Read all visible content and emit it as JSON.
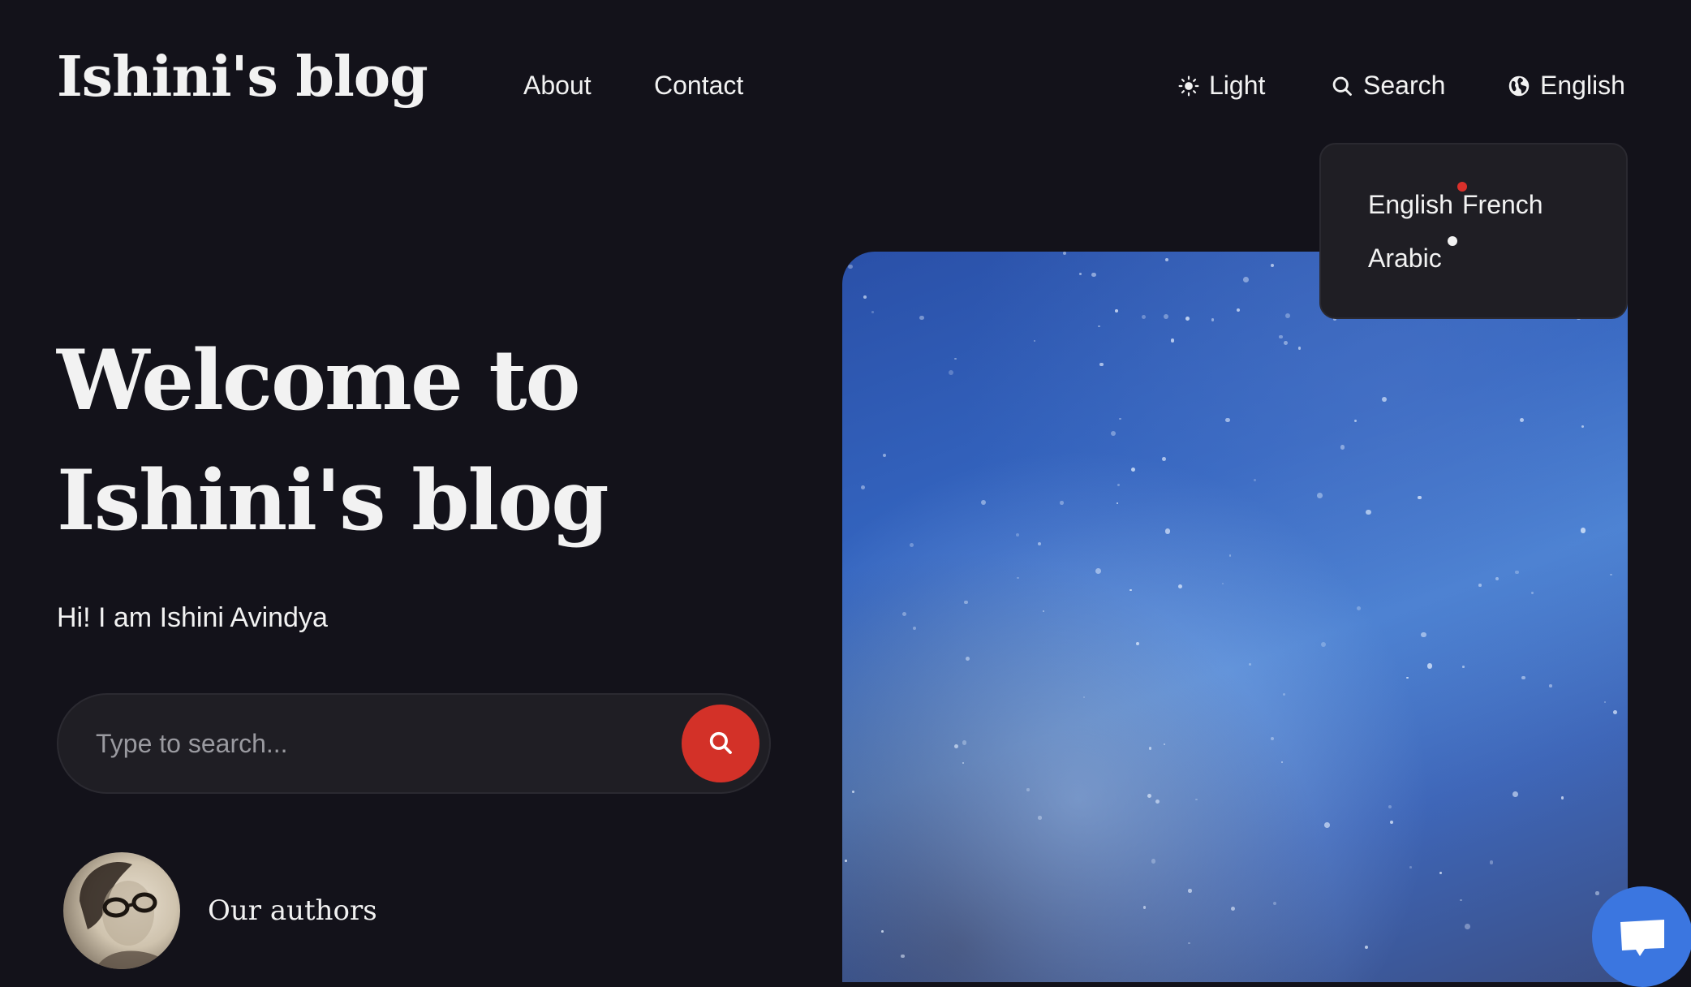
{
  "header": {
    "logo": "Ishini's blog",
    "nav": [
      {
        "label": "About"
      },
      {
        "label": "Contact"
      }
    ],
    "tools": {
      "theme_label": "Light",
      "theme_icon": "sun-icon",
      "search_label": "Search",
      "search_icon": "search-icon",
      "language_label": "English",
      "language_icon": "globe-icon"
    }
  },
  "language_dropdown": {
    "options": [
      {
        "label": "English"
      },
      {
        "label": "French"
      },
      {
        "label": "Arabic"
      }
    ]
  },
  "hero": {
    "title_line1": "Welcome to",
    "title_line2": "Ishini's blog",
    "subtitle": "Hi! I am Ishini Avindya",
    "search_placeholder": "Type to search...",
    "search_value": "",
    "image_description": "blue nebula space image"
  },
  "authors": {
    "label": "Our authors",
    "avatar_alt": "author portrait"
  },
  "chat": {
    "icon": "chat-bubble-icon"
  },
  "colors": {
    "background": "#13121a",
    "accent": "#d33128",
    "chat": "#3b76e0",
    "panel": "#1f1e24"
  }
}
